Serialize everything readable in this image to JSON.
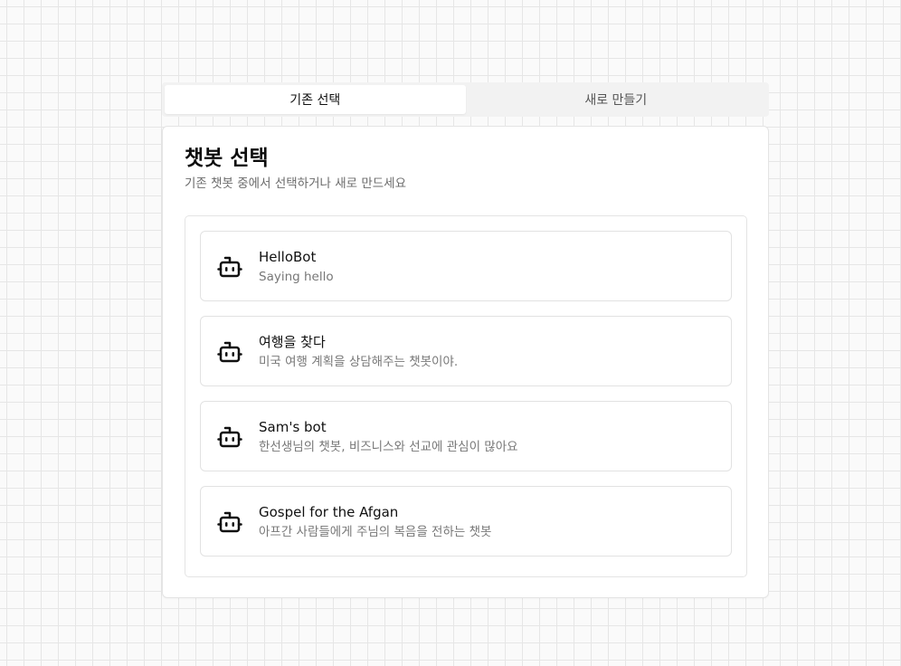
{
  "tabs": [
    {
      "label": "기존 선택",
      "active": true
    },
    {
      "label": "새로 만들기",
      "active": false
    }
  ],
  "card": {
    "title": "챗봇 선택",
    "subtitle": "기존 챗봇 중에서 선택하거나 새로 만드세요"
  },
  "bots": [
    {
      "name": "HelloBot",
      "description": "Saying hello",
      "icon": "bot-icon"
    },
    {
      "name": "여행을 찾다",
      "description": "미국 여행 계획을 상담해주는 챗봇이야.",
      "icon": "bot-icon"
    },
    {
      "name": "Sam's bot",
      "description": "한선생님의 챗봇, 비즈니스와 선교에 관심이 많아요",
      "icon": "bot-icon"
    },
    {
      "name": "Gospel for the Afgan",
      "description": "아프간 사람들에게 주님의 복음을 전하는 챗봇",
      "icon": "bot-icon"
    }
  ],
  "colors": {
    "background": "#fafafa",
    "grid_line": "#e6e6e6",
    "card_border": "#e4e4e4",
    "muted_text": "#777777"
  }
}
